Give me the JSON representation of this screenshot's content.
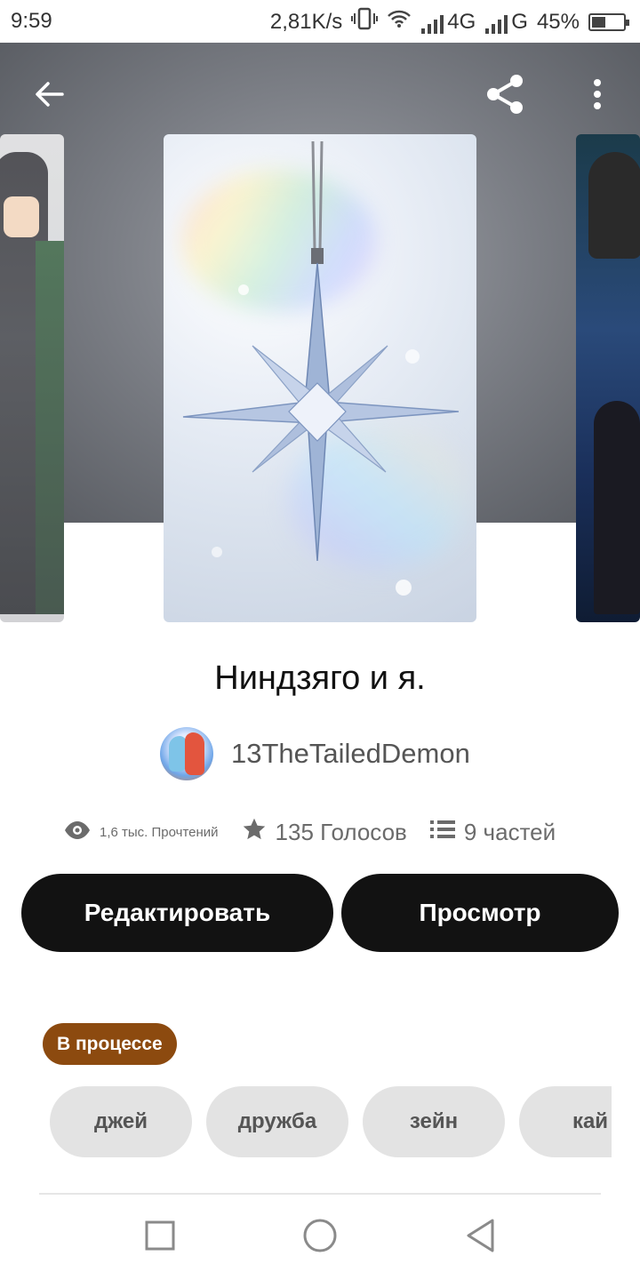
{
  "status_bar": {
    "time": "9:59",
    "speed": "2,81K/s",
    "network1": "4G",
    "network2": "G",
    "battery": "45%",
    "battery_level": 0.45
  },
  "topbar": {
    "back_icon": "arrow-left-icon",
    "share_icon": "share-icon",
    "more_icon": "more-vertical-icon"
  },
  "story": {
    "title": "Ниндзяго и я.",
    "author": "13TheTailedDemon",
    "reads": "1,6 тыс. Прочтений",
    "votes": "135 Голосов",
    "parts": "9 частей"
  },
  "actions": {
    "edit_label": "Редактировать",
    "preview_label": "Просмотр"
  },
  "status_badge": "В процессе",
  "tags": [
    "джей",
    "дружба",
    "зейн",
    "кай"
  ],
  "colors": {
    "button_bg": "#121212",
    "badge_bg": "#8c4a0f",
    "tag_bg": "#e3e3e3"
  }
}
